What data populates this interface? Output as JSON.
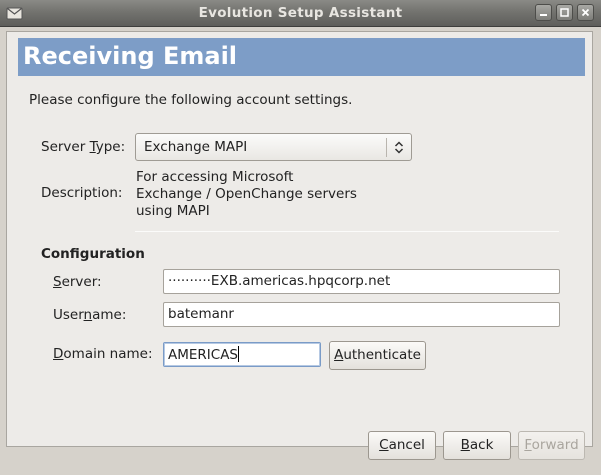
{
  "window": {
    "title": "Evolution Setup Assistant"
  },
  "page": {
    "heading": "Receiving Email",
    "intro": "Please configure the following account settings."
  },
  "server_type": {
    "label_pre": "Server ",
    "label_mnemonic": "T",
    "label_post": "ype:",
    "value": "Exchange MAPI"
  },
  "description": {
    "label": "Description:",
    "line1": "For accessing Microsoft",
    "line2": "Exchange / OpenChange servers",
    "line3": "using MAPI"
  },
  "configuration": {
    "heading": "Configuration",
    "server": {
      "label_mnemonic": "S",
      "label_post": "erver:",
      "value": "··········EXB.americas.hpqcorp.net"
    },
    "username": {
      "label_pre": "User",
      "label_mnemonic": "n",
      "label_post": "ame:",
      "value": "batemanr"
    },
    "domain": {
      "label_mnemonic": "D",
      "label_post": "omain name:",
      "value": "AMERICAS"
    },
    "authenticate": {
      "label_mnemonic": "A",
      "label_post": "uthenticate"
    }
  },
  "buttons": {
    "cancel": {
      "label_mnemonic": "C",
      "label_post": "ancel"
    },
    "back": {
      "label_mnemonic": "B",
      "label_post": "ack"
    },
    "forward": {
      "label_mnemonic": "F",
      "label_post": "orward"
    }
  },
  "colors": {
    "header": "#7d9dc7",
    "titlebar": "#73736f",
    "background": "#edebe8"
  },
  "icons": [
    "app-icon",
    "minimize-icon",
    "maximize-icon",
    "close-icon",
    "combo-arrows-icon"
  ]
}
